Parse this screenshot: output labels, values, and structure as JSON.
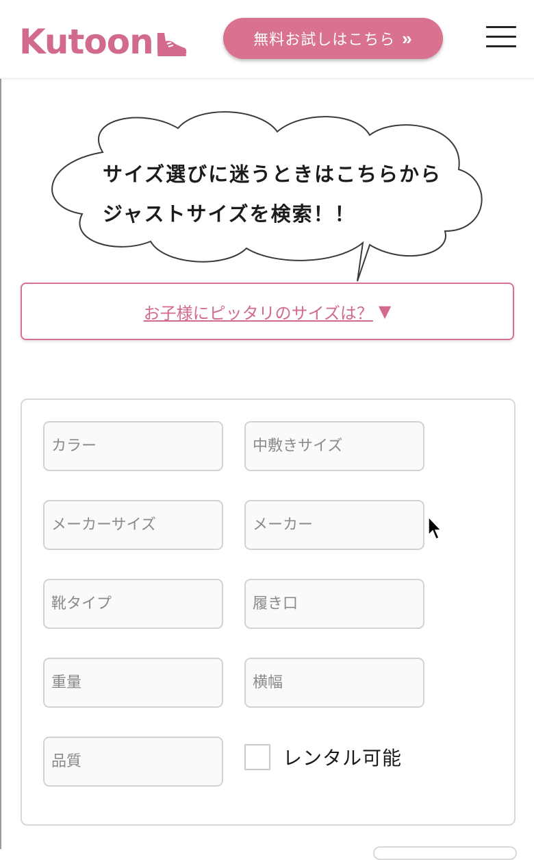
{
  "header": {
    "logo_text": "Kutoon",
    "trial_button_label": "無料お試しはこちら",
    "trial_button_icon": "double-chevron-right-icon",
    "menu_icon": "hamburger-menu-icon"
  },
  "bubble": {
    "line1": "サイズ選びに迷うときはこちらから",
    "line2": "ジャストサイズを検索！！"
  },
  "size_link": {
    "label": "お子様にピッタリのサイズは？",
    "arrow": "▼"
  },
  "filters": {
    "color_placeholder": "カラー",
    "insole_size_placeholder": "中敷きサイズ",
    "maker_size_placeholder": "メーカーサイズ",
    "maker_placeholder": "メーカー",
    "shoe_type_placeholder": "靴タイプ",
    "opening_placeholder": "履き口",
    "weight_placeholder": "重量",
    "width_placeholder": "横幅",
    "quality_placeholder": "品質",
    "rental_label": "レンタル可能"
  },
  "colors": {
    "brand_pink": "#d8728f",
    "text_dark": "#1c1c1c"
  }
}
